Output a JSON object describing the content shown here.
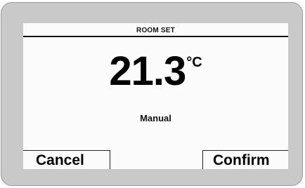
{
  "screen": {
    "header_title": "ROOM SET",
    "temperature": "21.3",
    "unit": "°C",
    "mode": "Manual"
  },
  "softkeys": {
    "cancel_label": "Cancel",
    "confirm_label": "Confirm"
  },
  "colors": {
    "bezel": "#c9c9c9",
    "screen": "#fbfbfb",
    "text": "#000000"
  }
}
